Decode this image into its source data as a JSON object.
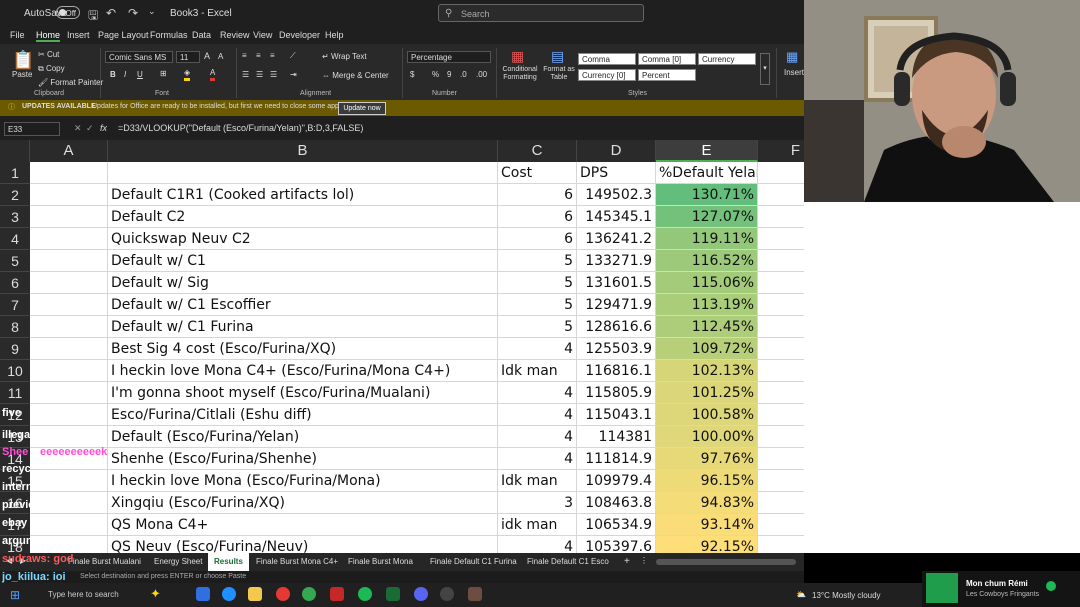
{
  "titlebar": {
    "autosave": "AutoSave",
    "toggle": "Off",
    "doc_title": "Book3 - Excel",
    "search_placeholder": "Search"
  },
  "menu": [
    "File",
    "Home",
    "Insert",
    "Page Layout",
    "Formulas",
    "Data",
    "Review",
    "View",
    "Developer",
    "Help"
  ],
  "ribbon": {
    "paste": "Paste",
    "cut": "Cut",
    "copy": "Copy",
    "format_painter": "Format Painter",
    "clipboard": "Clipboard",
    "font_name": "Comic Sans MS",
    "font_size": "11",
    "font_group": "Font",
    "wrap_text": "Wrap Text",
    "merge_center": "Merge & Center",
    "alignment": "Alignment",
    "number_format": "Percentage",
    "number_group": "Number",
    "cond_format": "Conditional Formatting",
    "format_table": "Format as Table",
    "styles": [
      "Comma",
      "Comma [0]",
      "Currency",
      "Currency [0]",
      "Percent"
    ],
    "styles_group": "Styles",
    "insert": "Insert"
  },
  "update_bar": {
    "title": "UPDATES AVAILABLE",
    "message": "Updates for Office are ready to be installed, but first we need to close some apps.",
    "button": "Update now"
  },
  "formula": {
    "namebox": "E33",
    "fx": "fx",
    "text": "=D33/VLOOKUP(\"Default (Esco/Furina/Yelan)\",B:D,3,FALSE)"
  },
  "columns": [
    "A",
    "B",
    "C",
    "D",
    "E",
    "F"
  ],
  "header_row": {
    "B": "",
    "C": "Cost",
    "D": "DPS",
    "E": "%Default Yelan"
  },
  "rows": [
    {
      "n": "1"
    },
    {
      "n": "2",
      "b": "Default C1R1 (Cooked artifacts lol)",
      "c": "6",
      "d": "149502.3",
      "e": "130.71%"
    },
    {
      "n": "3",
      "b": "Default C2",
      "c": "6",
      "d": "145345.1",
      "e": "127.07%"
    },
    {
      "n": "4",
      "b": "Quickswap Neuv C2",
      "c": "6",
      "d": "136241.2",
      "e": "119.11%"
    },
    {
      "n": "5",
      "b": "Default w/ C1",
      "c": "5",
      "d": "133271.9",
      "e": "116.52%"
    },
    {
      "n": "6",
      "b": "Default w/ Sig",
      "c": "5",
      "d": "131601.5",
      "e": "115.06%"
    },
    {
      "n": "7",
      "b": "Default w/ C1 Escoffier",
      "c": "5",
      "d": "129471.9",
      "e": "113.19%"
    },
    {
      "n": "8",
      "b": "Default w/ C1 Furina",
      "c": "5",
      "d": "128616.6",
      "e": "112.45%"
    },
    {
      "n": "9",
      "b": "Best Sig 4 cost (Esco/Furina/XQ)",
      "c": "4",
      "d": "125503.9",
      "e": "109.72%"
    },
    {
      "n": "10",
      "b": "I heckin love Mona C4+ (Esco/Furina/Mona C4+)",
      "c": "Idk man",
      "d": "116816.1",
      "e": "102.13%"
    },
    {
      "n": "11",
      "b": "I'm gonna shoot myself (Esco/Furina/Mualani)",
      "c": "4",
      "d": "115805.9",
      "e": "101.25%"
    },
    {
      "n": "12",
      "b": "Esco/Furina/Citlali (Eshu diff)",
      "c": "4",
      "d": "115043.1",
      "e": "100.58%"
    },
    {
      "n": "13",
      "b": "Default (Esco/Furina/Yelan)",
      "c": "4",
      "d": "114381",
      "e": "100.00%"
    },
    {
      "n": "14",
      "b": "Shenhe (Esco/Furina/Shenhe)",
      "c": "4",
      "d": "111814.9",
      "e": "97.76%"
    },
    {
      "n": "15",
      "b": "I heckin love Mona (Esco/Furina/Mona)",
      "c": "Idk man",
      "d": "109979.4",
      "e": "96.15%"
    },
    {
      "n": "16",
      "b": "Xingqiu (Esco/Furina/XQ)",
      "c": "3",
      "d": "108463.8",
      "e": "94.83%"
    },
    {
      "n": "17",
      "b": "QS Mona C4+",
      "c": "idk man",
      "d": "106534.9",
      "e": "93.14%"
    },
    {
      "n": "18",
      "b": "QS Neuv (Esco/Furina/Neuv)",
      "c": "4",
      "d": "105397.6",
      "e": "92.15%"
    }
  ],
  "sheet_tabs": [
    "Finale Burst Mualani",
    "Energy Sheet",
    "Results",
    "Finale Burst Mona C4+",
    "Finale Burst Mona",
    "Finale Default C1 Furina",
    "Finale Default C1 Esco"
  ],
  "active_tab": "Results",
  "statusbar": {
    "text": "Select destination and press ENTER or choose Paste"
  },
  "chat": [
    {
      "t": "five",
      "c": "#ffffff"
    },
    {
      "t": "illega",
      "c": "#ffffff"
    },
    {
      "t": "Shee",
      "c": "#ff4fd8"
    },
    {
      "t": "eeeeeeeeeek",
      "c": "#ff4fd8"
    },
    {
      "t": "recyc",
      "c": "#ffffff"
    },
    {
      "t": "intern",
      "c": "#ffffff"
    },
    {
      "t": "previo",
      "c": "#ffffff"
    },
    {
      "t": "ebay",
      "c": "#ffffff"
    },
    {
      "t": "argun",
      "c": "#ffffff"
    },
    {
      "t": "sudraws: god",
      "c": "#ff5a5a"
    },
    {
      "t": "jo_kiilua: ioi",
      "c": "#7fd7ff"
    },
    {
      "t": "deepacoun",
      "c": "#c08cff"
    }
  ],
  "taskbar": {
    "search": "Type here to search",
    "weather": "13°C  Mostly cloudy"
  },
  "spotify": {
    "title": "Mon chum Rémi",
    "artist": "Les Cowboys Fringants"
  },
  "colors": {
    "excel_green": "#1a6b34",
    "accent": "#4caf50"
  }
}
